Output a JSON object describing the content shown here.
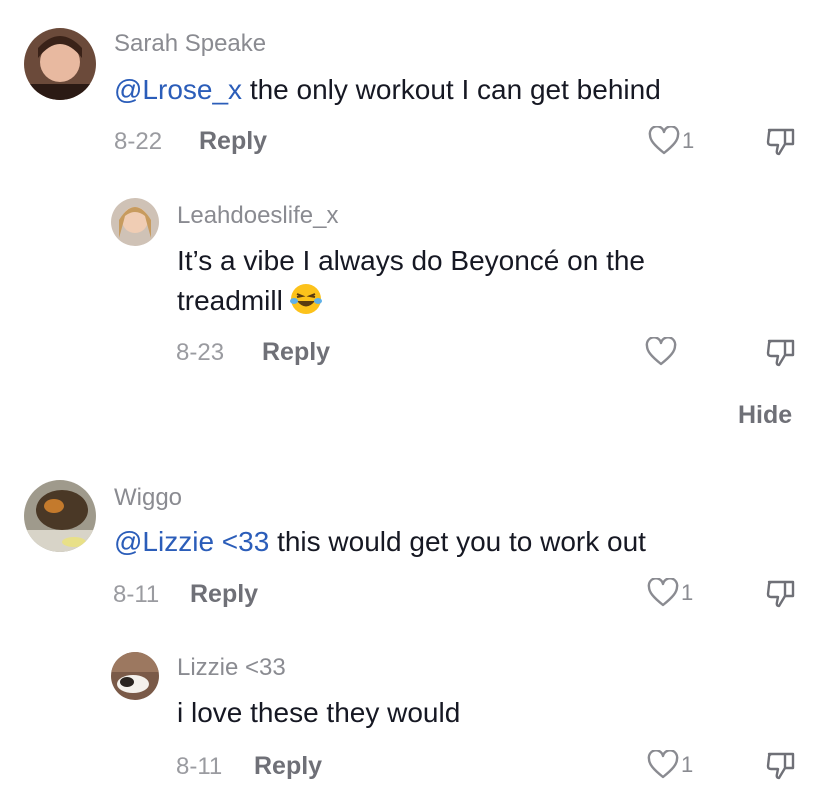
{
  "comments": [
    {
      "username": "Sarah Speake",
      "mention": "@Lrose_x",
      "text": " the only workout I can get behind",
      "date": "8-22",
      "reply_label": "Reply",
      "likes": "1",
      "icons": {
        "like": "heart-outline-icon",
        "dislike": "thumbs-down-icon"
      }
    },
    {
      "username": "Leahdoeslife_x",
      "line1": "It’s a vibe I always do Beyoncé on the",
      "line2": "treadmill",
      "emoji": "😂",
      "date": "8-23",
      "reply_label": "Reply",
      "likes": "",
      "icons": {
        "like": "heart-outline-icon",
        "dislike": "thumbs-down-icon"
      }
    },
    {
      "username": "Wiggo",
      "mention": "@Lizzie <33",
      "text": " this would get you to work out",
      "date": "8-11",
      "reply_label": "Reply",
      "likes": "1",
      "icons": {
        "like": "heart-outline-icon",
        "dislike": "thumbs-down-icon"
      }
    },
    {
      "username": "Lizzie <33",
      "text": "i love these they would",
      "date": "8-11",
      "reply_label": "Reply",
      "likes": "1",
      "icons": {
        "like": "heart-outline-icon",
        "dislike": "thumbs-down-icon"
      }
    }
  ],
  "hide_label": "Hide",
  "colors": {
    "mention": "#2b5db9",
    "text": "#161823",
    "muted": "#8a8b91",
    "reply": "#6f7077"
  }
}
